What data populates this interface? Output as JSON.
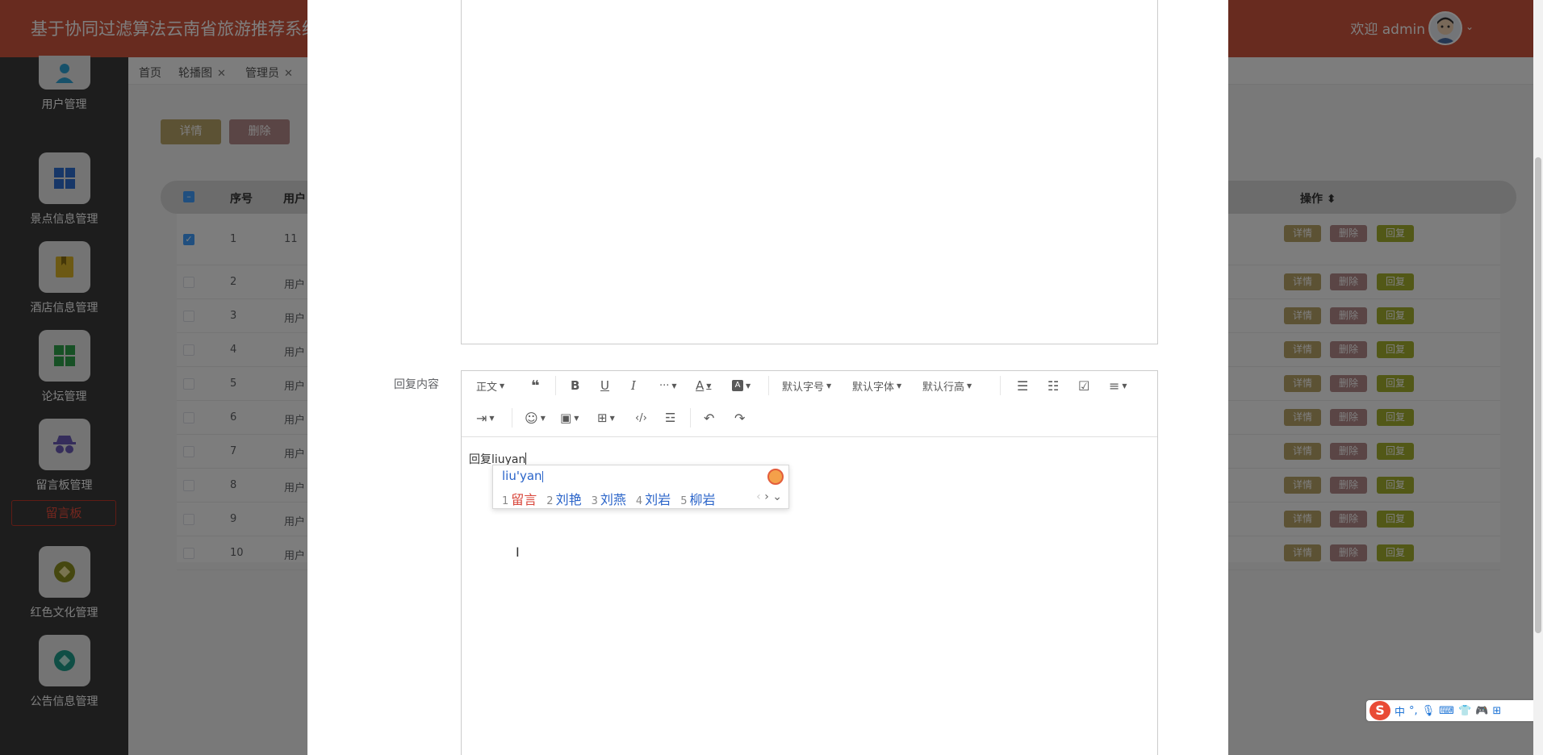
{
  "header": {
    "title": "基于协同过滤算法云南省旅游推荐系统",
    "welcome": "欢迎 admin"
  },
  "sidebar": {
    "items": [
      {
        "label": "用户管理",
        "icon": "user-icon",
        "color": "#2fa3d4"
      },
      {
        "label": "景点信息管理",
        "icon": "grid-icon",
        "color": "#2f6fd1"
      },
      {
        "label": "酒店信息管理",
        "icon": "bookmark-icon",
        "color": "#d8b229"
      },
      {
        "label": "论坛管理",
        "icon": "grid-icon",
        "color": "#2fa04a"
      },
      {
        "label": "留言板管理",
        "icon": "incognito-icon",
        "color": "#6b5bb6"
      },
      {
        "label": "红色文化管理",
        "icon": "diamond-icon",
        "color": "#8a8f1e"
      },
      {
        "label": "公告信息管理",
        "icon": "diamond-icon",
        "color": "#1e9c8a"
      }
    ],
    "sub_item": "留言板"
  },
  "tags": [
    {
      "label": "首页",
      "closable": false
    },
    {
      "label": "轮播图",
      "closable": true
    },
    {
      "label": "管理员",
      "closable": true
    }
  ],
  "actions": {
    "detail": "详情",
    "delete": "删除"
  },
  "table": {
    "headers": {
      "index": "序号",
      "user": "用户",
      "ops": "操作"
    },
    "rows": [
      {
        "index": "1",
        "user": "11",
        "checked": true
      },
      {
        "index": "2",
        "user": "用户"
      },
      {
        "index": "3",
        "user": "用户"
      },
      {
        "index": "4",
        "user": "用户"
      },
      {
        "index": "5",
        "user": "用户"
      },
      {
        "index": "6",
        "user": "用户"
      },
      {
        "index": "7",
        "user": "用户"
      },
      {
        "index": "8",
        "user": "用户"
      },
      {
        "index": "9",
        "user": "用户"
      },
      {
        "index": "10",
        "user": "用户"
      }
    ],
    "row_buttons": {
      "detail": "详情",
      "delete": "删除",
      "reply": "回复"
    }
  },
  "colors": {
    "header": "#d0573e",
    "detail_btn": "#b8a469",
    "delete_btn": "#b58a8a",
    "reply_btn": "#a4b02e"
  },
  "dialog": {
    "reply_label": "回复内容",
    "toolbar": {
      "paragraph": "正文",
      "font_size": "默认字号",
      "font_family": "默认字体",
      "line_height": "默认行高"
    },
    "editor_text": "回复liuyan"
  },
  "ime": {
    "pinyin": "liu'yan",
    "candidates": [
      {
        "n": "1",
        "word": "留言"
      },
      {
        "n": "2",
        "word": "刘艳"
      },
      {
        "n": "3",
        "word": "刘燕"
      },
      {
        "n": "4",
        "word": "刘岩"
      },
      {
        "n": "5",
        "word": "柳岩"
      }
    ]
  },
  "tray": {
    "lang": "中"
  }
}
